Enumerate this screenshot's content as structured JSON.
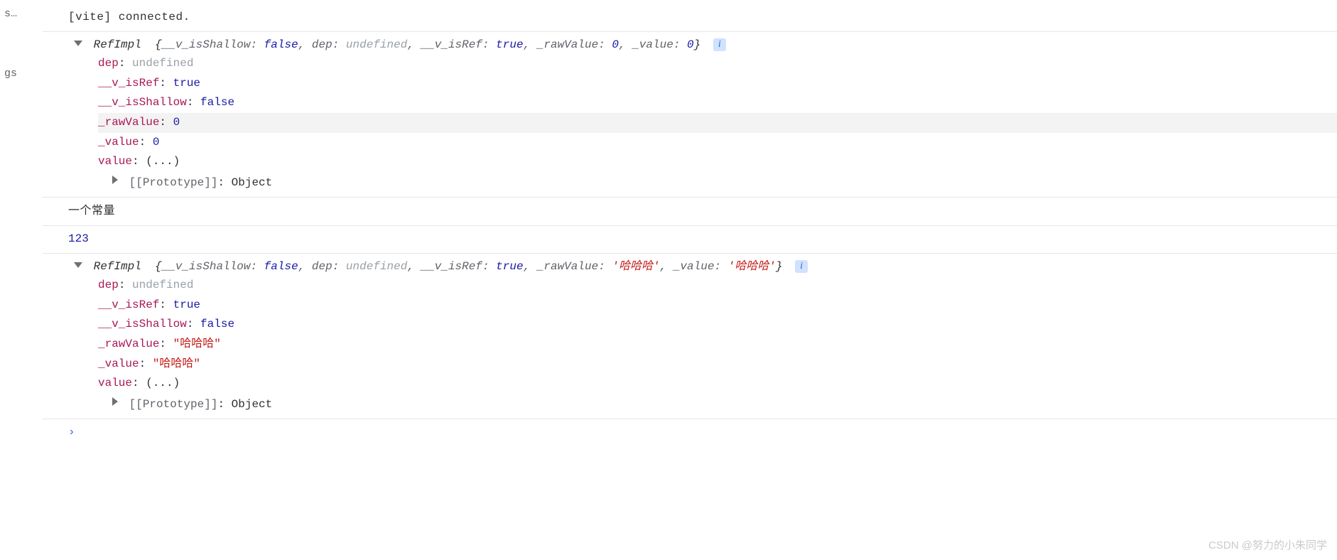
{
  "sidebar": {
    "items": [
      "s…",
      "gs"
    ]
  },
  "log1": {
    "text": "[vite] connected."
  },
  "obj1": {
    "class_name": "RefImpl",
    "summary": {
      "p0_key": "__v_isShallow",
      "p0_val": "false",
      "p1_key": "dep",
      "p1_val": "undefined",
      "p2_key": "__v_isRef",
      "p2_val": "true",
      "p3_key": "_rawValue",
      "p3_val": "0",
      "p4_key": "_value",
      "p4_val": "0"
    },
    "props": {
      "dep_key": "dep",
      "dep_val": "undefined",
      "isref_key": "__v_isRef",
      "isref_val": "true",
      "shallow_key": "__v_isShallow",
      "shallow_val": "false",
      "raw_key": "_rawValue",
      "raw_val": "0",
      "val_key": "_value",
      "val_val": "0",
      "getter_key": "value",
      "getter_val": "(...)",
      "proto_key": "[[Prototype]]",
      "proto_val": "Object"
    },
    "info": "i"
  },
  "log2": {
    "text": "一个常量"
  },
  "log3": {
    "text": "123"
  },
  "obj2": {
    "class_name": "RefImpl",
    "summary": {
      "p0_key": "__v_isShallow",
      "p0_val": "false",
      "p1_key": "dep",
      "p1_val": "undefined",
      "p2_key": "__v_isRef",
      "p2_val": "true",
      "p3_key": "_rawValue",
      "p3_val": "'哈哈哈'",
      "p4_key": "_value",
      "p4_val": "'哈哈哈'"
    },
    "props": {
      "dep_key": "dep",
      "dep_val": "undefined",
      "isref_key": "__v_isRef",
      "isref_val": "true",
      "shallow_key": "__v_isShallow",
      "shallow_val": "false",
      "raw_key": "_rawValue",
      "raw_val": "\"哈哈哈\"",
      "val_key": "_value",
      "val_val": "\"哈哈哈\"",
      "getter_key": "value",
      "getter_val": "(...)",
      "proto_key": "[[Prototype]]",
      "proto_val": "Object"
    },
    "info": "i"
  },
  "prompt": {
    "caret": "›"
  },
  "watermark": "CSDN @努力的小朱同学"
}
